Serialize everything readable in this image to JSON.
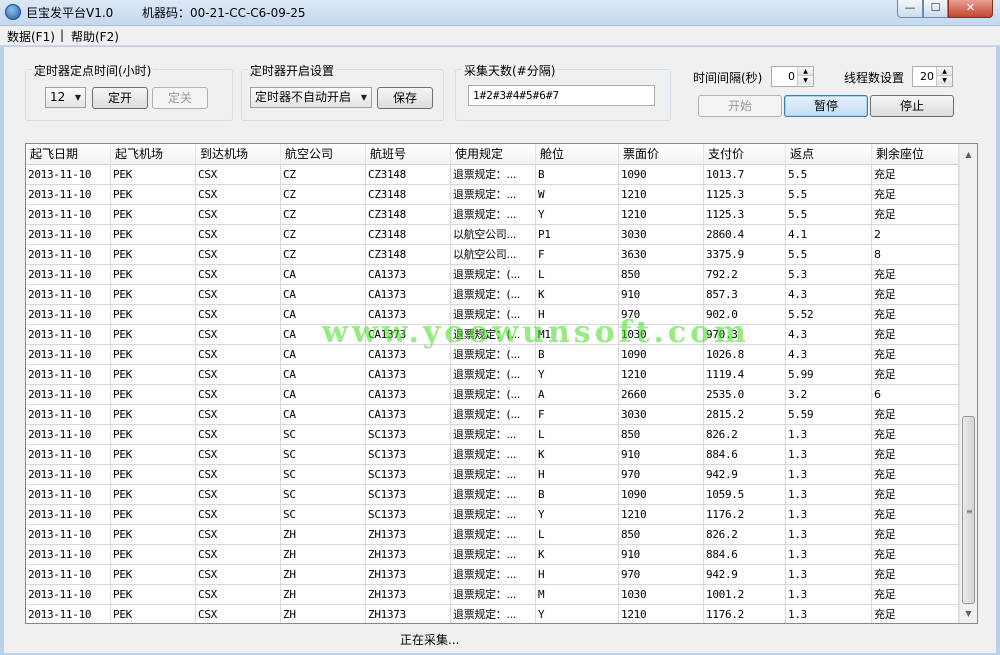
{
  "window": {
    "title": "巨宝发平台V1.0",
    "machine_code": "机器码：00-21-CC-C6-09-25",
    "minimize_glyph": "—",
    "maximize_glyph": "☐",
    "close_glyph": "✕"
  },
  "menu": {
    "items": [
      "数据(F1)",
      "帮助(F2)"
    ],
    "separator": "|"
  },
  "timer_time": {
    "group_label": "定时器定点时间(小时)",
    "hour_value": "12",
    "start_label": "定开",
    "stop_label": "定关"
  },
  "timer_mode": {
    "group_label": "定时器开启设置",
    "selected": "定时器不自动开启",
    "save_label": "保存"
  },
  "collect_days": {
    "group_label": "采集天数(#分隔)",
    "value": "1#2#3#4#5#6#7"
  },
  "controls": {
    "interval_label": "时间间隔(秒)",
    "interval_value": "0",
    "threads_label": "线程数设置",
    "threads_value": "20",
    "start_label": "开始",
    "pause_label": "暂停",
    "stop_label": "停止"
  },
  "table": {
    "columns": [
      "起飞日期",
      "起飞机场",
      "到达机场",
      "航空公司",
      "航班号",
      "使用规定",
      "舱位",
      "票面价",
      "支付价",
      "返点",
      "剩余座位"
    ],
    "rows": [
      [
        "2013-11-10",
        "PEK",
        "CSX",
        "CZ",
        "CZ3148",
        "退票规定：...",
        "B",
        "1090",
        "1013.7",
        "5.5",
        "充足"
      ],
      [
        "2013-11-10",
        "PEK",
        "CSX",
        "CZ",
        "CZ3148",
        " 退票规定：...",
        "W",
        "1210",
        "1125.3",
        "5.5",
        "充足"
      ],
      [
        "2013-11-10",
        "PEK",
        "CSX",
        "CZ",
        "CZ3148",
        "退票规定：...",
        "Y",
        "1210",
        "1125.3",
        "5.5",
        "充足"
      ],
      [
        "2013-11-10",
        "PEK",
        "CSX",
        "CZ",
        "CZ3148",
        "以航空公司...",
        "P1",
        "3030",
        "2860.4",
        "4.1",
        "2"
      ],
      [
        "2013-11-10",
        "PEK",
        "CSX",
        "CZ",
        "CZ3148",
        "以航空公司...",
        "F",
        "3630",
        "3375.9",
        "5.5",
        "8"
      ],
      [
        "2013-11-10",
        "PEK",
        "CSX",
        "CA",
        "CA1373",
        "退票规定：(...",
        "L",
        "850",
        "792.2",
        "5.3",
        "充足"
      ],
      [
        "2013-11-10",
        "PEK",
        "CSX",
        "CA",
        "CA1373",
        "退票规定：(...",
        "K",
        "910",
        "857.3",
        "4.3",
        "充足"
      ],
      [
        "2013-11-10",
        "PEK",
        "CSX",
        "CA",
        "CA1373",
        "退票规定：(...",
        "H",
        "970",
        "902.0",
        "5.52",
        "充足"
      ],
      [
        "2013-11-10",
        "PEK",
        "CSX",
        "CA",
        "CA1373",
        "退票规定：(...",
        "M1",
        "1030",
        "970.3",
        "4.3",
        "充足"
      ],
      [
        "2013-11-10",
        "PEK",
        "CSX",
        "CA",
        "CA1373",
        "退票规定：(...",
        "B",
        "1090",
        "1026.8",
        "4.3",
        "充足"
      ],
      [
        "2013-11-10",
        "PEK",
        "CSX",
        "CA",
        "CA1373",
        "退票规定：(...",
        "Y",
        "1210",
        "1119.4",
        "5.99",
        "充足"
      ],
      [
        "2013-11-10",
        "PEK",
        "CSX",
        "CA",
        "CA1373",
        "退票规定：(...",
        "A",
        "2660",
        "2535.0",
        "3.2",
        "6"
      ],
      [
        "2013-11-10",
        "PEK",
        "CSX",
        "CA",
        "CA1373",
        "退票规定：(...",
        "F",
        "3030",
        "2815.2",
        "5.59",
        "充足"
      ],
      [
        "2013-11-10",
        "PEK",
        "CSX",
        "SC",
        "SC1373",
        "退票规定：...",
        "L",
        "850",
        "826.2",
        "1.3",
        "充足"
      ],
      [
        "2013-11-10",
        "PEK",
        "CSX",
        "SC",
        "SC1373",
        "退票规定：...",
        "K",
        "910",
        "884.6",
        "1.3",
        "充足"
      ],
      [
        "2013-11-10",
        "PEK",
        "CSX",
        "SC",
        "SC1373",
        "退票规定：...",
        "H",
        "970",
        "942.9",
        "1.3",
        "充足"
      ],
      [
        "2013-11-10",
        "PEK",
        "CSX",
        "SC",
        "SC1373",
        "退票规定：...",
        "B",
        "1090",
        "1059.5",
        "1.3",
        "充足"
      ],
      [
        "2013-11-10",
        "PEK",
        "CSX",
        "SC",
        "SC1373",
        "退票规定：...",
        "Y",
        "1210",
        "1176.2",
        "1.3",
        "充足"
      ],
      [
        "2013-11-10",
        "PEK",
        "CSX",
        "ZH",
        "ZH1373",
        "退票规定：...",
        "L",
        "850",
        "826.2",
        "1.3",
        "充足"
      ],
      [
        "2013-11-10",
        "PEK",
        "CSX",
        "ZH",
        "ZH1373",
        "退票规定：...",
        "K",
        "910",
        "884.6",
        "1.3",
        "充足"
      ],
      [
        "2013-11-10",
        "PEK",
        "CSX",
        "ZH",
        "ZH1373",
        "退票规定：...",
        "H",
        "970",
        "942.9",
        "1.3",
        "充足"
      ],
      [
        "2013-11-10",
        "PEK",
        "CSX",
        "ZH",
        "ZH1373",
        "退票规定：...",
        "M",
        "1030",
        "1001.2",
        "1.3",
        "充足"
      ],
      [
        "2013-11-10",
        "PEK",
        "CSX",
        "ZH",
        "ZH1373",
        "退票规定：...",
        "Y",
        "1210",
        "1176.2",
        "1.3",
        "充足"
      ]
    ]
  },
  "scrollbar": {
    "up_arrow": "▲",
    "down_arrow": "▼",
    "grip": "≡"
  },
  "watermark": "www.yoowunsoft.com",
  "status_text": "正在采集..."
}
